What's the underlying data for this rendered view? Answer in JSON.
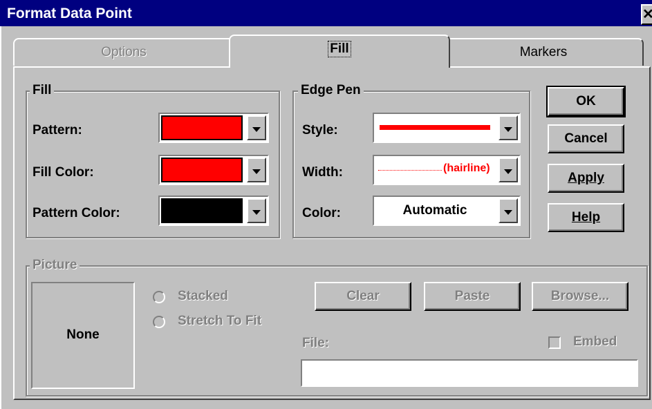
{
  "window": {
    "title": "Format Data Point",
    "close_glyph": "✕"
  },
  "tabs": [
    {
      "label": "Options",
      "state": "disabled"
    },
    {
      "label": "Fill",
      "state": "selected"
    },
    {
      "label": "Markers",
      "state": "normal"
    }
  ],
  "fill_group": {
    "legend": "Fill",
    "pattern_label": "Pattern:",
    "pattern_color": "#ff0000",
    "fill_color_label": "Fill Color:",
    "fill_color": "#ff0000",
    "pattern_color_label": "Pattern Color:",
    "pattern_color_value": "#000000"
  },
  "edge_pen": {
    "legend": "Edge Pen",
    "style_label": "Style:",
    "style_color": "#ff0000",
    "width_label": "Width:",
    "width_value": "(hairline)",
    "color_label": "Color:",
    "color_value": "Automatic"
  },
  "buttons": {
    "ok": "OK",
    "cancel": "Cancel",
    "apply": "Apply",
    "help": "Help"
  },
  "picture": {
    "legend": "Picture",
    "preview_text": "None",
    "stacked_label": "Stacked",
    "stretch_label": "Stretch To Fit",
    "clear": "Clear",
    "paste": "Paste",
    "browse": "Browse...",
    "file_label": "File:",
    "file_value": "",
    "embed_label": "Embed"
  },
  "icons": {
    "dropdown": "chevron-down-icon",
    "close": "close-icon"
  }
}
